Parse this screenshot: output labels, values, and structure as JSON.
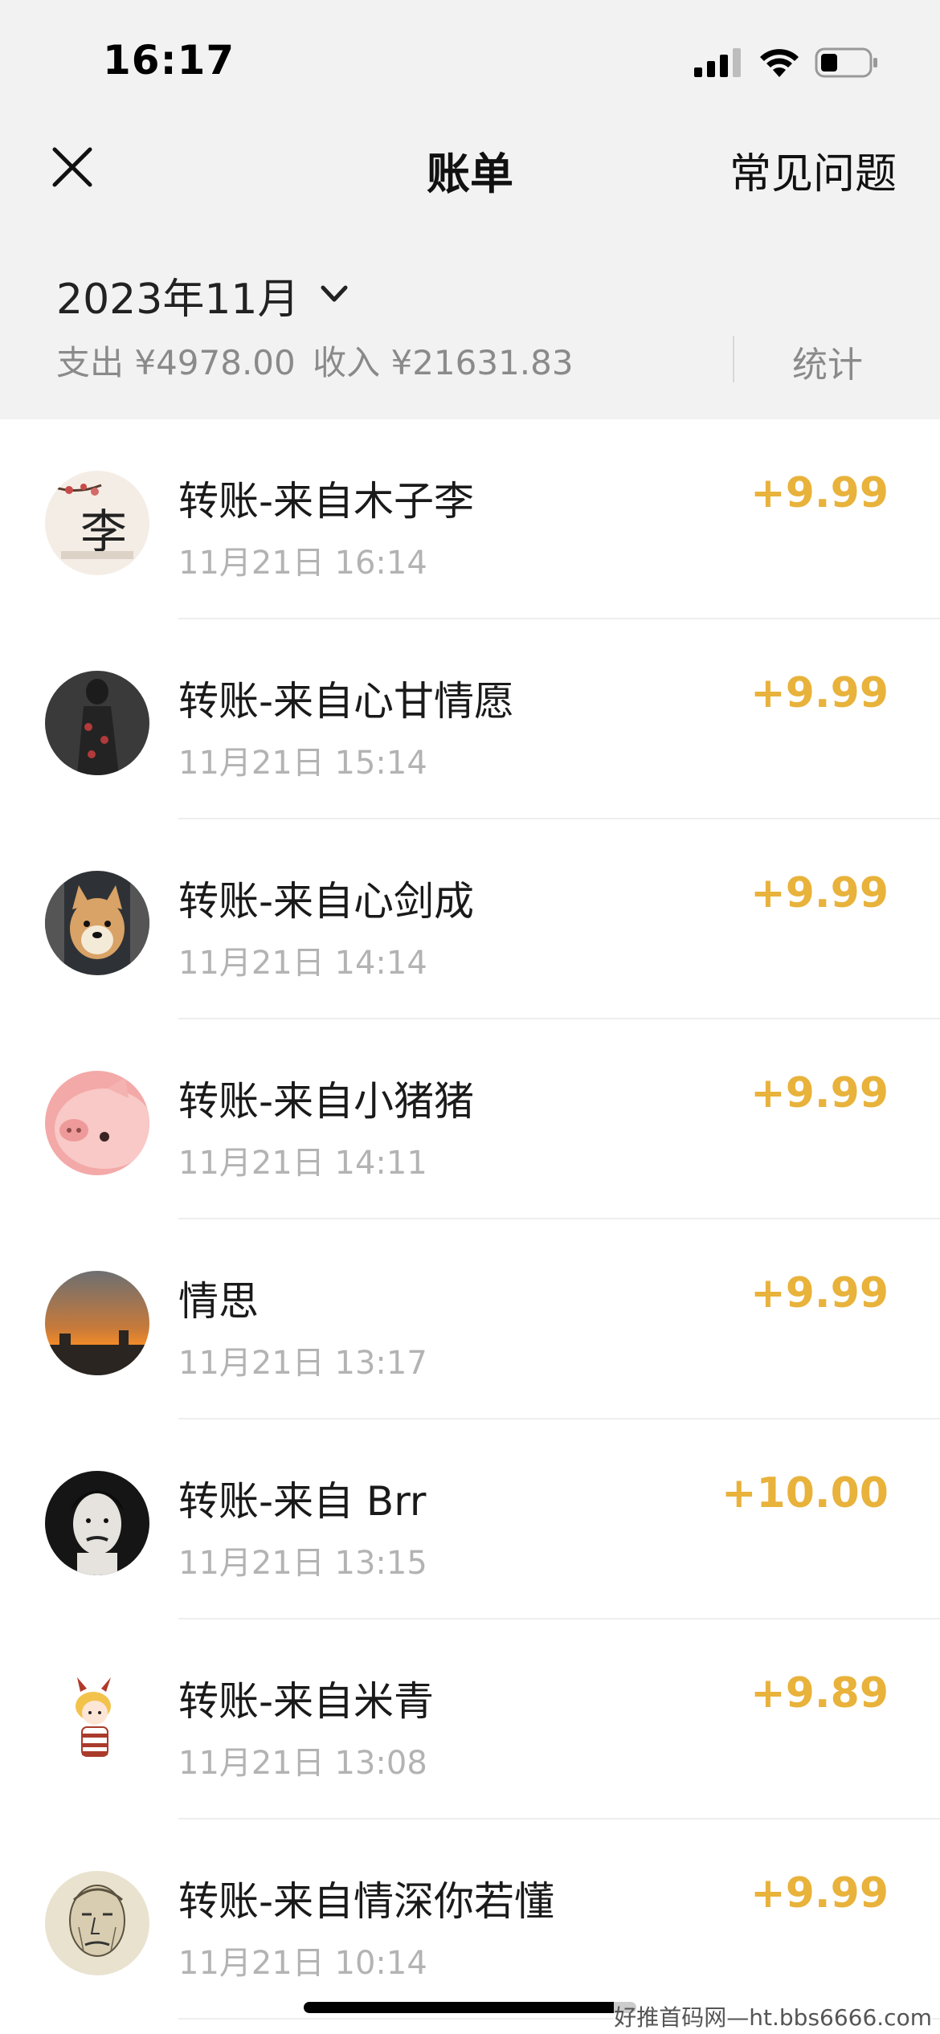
{
  "status_bar": {
    "time": "16:17"
  },
  "nav": {
    "title": "账单",
    "right_link": "常见问题"
  },
  "summary": {
    "month": "2023年11月",
    "expense": "支出 ¥4978.00",
    "income": "收入 ¥21631.83",
    "stats_label": "统计"
  },
  "transactions": [
    {
      "title": "转账-来自木子李",
      "time": "11月21日 16:14",
      "amount": "+9.99"
    },
    {
      "title": "转账-来自心甘情愿",
      "time": "11月21日 15:14",
      "amount": "+9.99"
    },
    {
      "title": "转账-来自心剑成",
      "time": "11月21日 14:14",
      "amount": "+9.99"
    },
    {
      "title": "转账-来自小猪猪",
      "time": "11月21日 14:11",
      "amount": "+9.99"
    },
    {
      "title": "情思",
      "time": "11月21日 13:17",
      "amount": "+9.99"
    },
    {
      "title": "转账-来自 Brr",
      "time": "11月21日 13:15",
      "amount": "+10.00"
    },
    {
      "title": "转账-来自米青",
      "time": "11月21日 13:08",
      "amount": "+9.89"
    },
    {
      "title": "转账-来自情深你若懂",
      "time": "11月21日 10:14",
      "amount": "+9.99"
    }
  ],
  "watermark": "好推首码网—ht.bbs6666.com",
  "colors": {
    "amount": "#e8b23b",
    "header_bg": "#f2f2f2"
  }
}
